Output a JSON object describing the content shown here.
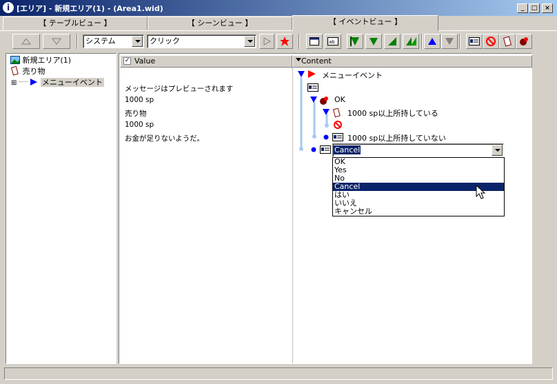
{
  "window": {
    "title": "[エリア] - 新規エリア(1) - (Area1.wid)",
    "icon_letter": "i",
    "buttons": [
      "_",
      "□",
      "×"
    ]
  },
  "tabs": [
    {
      "label": "【 テーブルビュー 】",
      "active": false
    },
    {
      "label": "【 シーンビュー 】",
      "active": false
    },
    {
      "label": "【 イベントビュー 】",
      "active": true
    }
  ],
  "toolbar": {
    "category_value": "システム",
    "action_value": "クリック",
    "colors": {
      "green": "#008000",
      "blue": "#0000ff",
      "red": "#ff0000"
    }
  },
  "tree": {
    "items": [
      {
        "label": "新規エリア(1)",
        "icon": "area-icon"
      },
      {
        "label": "売り物",
        "icon": "card-icon"
      },
      {
        "label": "メニューイベント",
        "icon": "play-icon",
        "expander": "⊞"
      }
    ]
  },
  "value_panel": {
    "header": "Value",
    "rows": [
      "メッセージはプレビューされます",
      "1000 sp",
      "売り物",
      "1000 sp",
      "お金が足りないようだ。"
    ]
  },
  "content_panel": {
    "header": "Content",
    "nodes": {
      "menu_event": "メニューイベント",
      "ok": "OK",
      "has_sp": "1000 sp以上所持している",
      "not_has_sp": "1000 sp以上所持していない"
    },
    "combo_value": "Cancel",
    "dropdown_options": [
      "OK",
      "Yes",
      "No",
      "Cancel",
      "はい",
      "いいえ",
      "キャンセル"
    ],
    "dropdown_selected": "Cancel"
  },
  "statusbar": {
    "text": ""
  }
}
